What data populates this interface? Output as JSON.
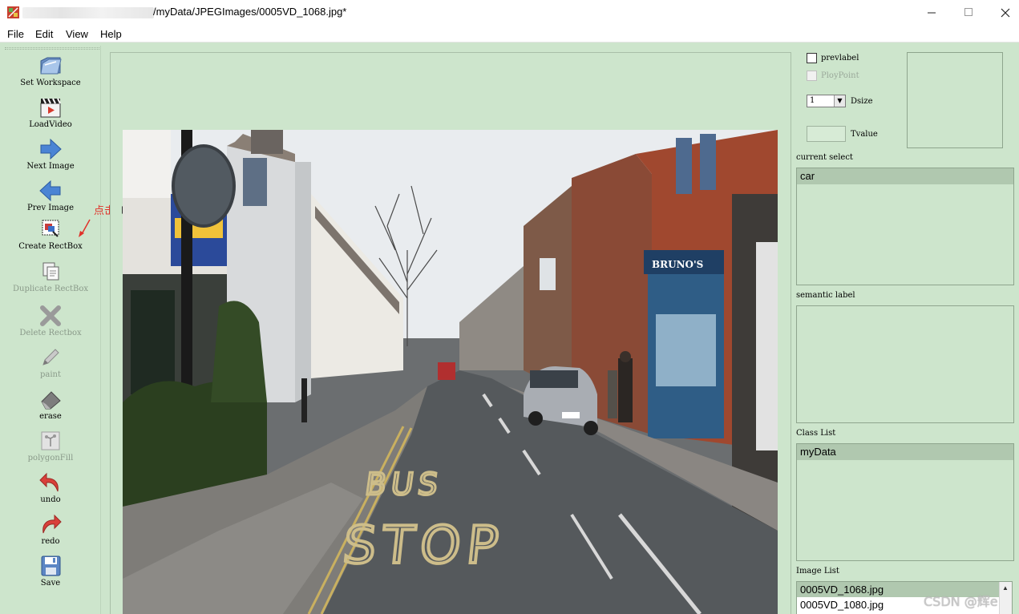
{
  "window": {
    "title": "/myData/JPEGImages/0005VD_1068.jpg*",
    "minimize": "—",
    "maximize": "☐",
    "close": "✕"
  },
  "menu": [
    "File",
    "Edit",
    "View",
    "Help"
  ],
  "toolbar": [
    {
      "label": "Set Workspace",
      "icon": "folder-icon",
      "enabled": true
    },
    {
      "label": "LoadVideo",
      "icon": "video-clapper-icon",
      "enabled": true
    },
    {
      "label": "Next Image",
      "icon": "arrow-right-icon",
      "enabled": true
    },
    {
      "label": "Prev Image",
      "icon": "arrow-left-icon",
      "enabled": true
    },
    {
      "label": "Create RectBox",
      "icon": "create-rectbox-icon",
      "enabled": true
    },
    {
      "label": "Duplicate RectBox",
      "icon": "duplicate-icon",
      "enabled": false
    },
    {
      "label": "Delete Rectbox",
      "icon": "delete-icon",
      "enabled": false
    },
    {
      "label": "paint",
      "icon": "pencil-icon",
      "enabled": false
    },
    {
      "label": "erase",
      "icon": "eraser-icon",
      "enabled": true
    },
    {
      "label": "polygonFill",
      "icon": "polygon-fill-icon",
      "enabled": false
    },
    {
      "label": "undo",
      "icon": "undo-icon",
      "enabled": true
    },
    {
      "label": "redo",
      "icon": "redo-icon",
      "enabled": true
    },
    {
      "label": "Save",
      "icon": "save-icon",
      "enabled": true
    }
  ],
  "annotation": "点击",
  "panel": {
    "prevlabel": "prevlabel",
    "ploypoint": "PloyPoint",
    "dsize_value": "1",
    "dsize_label": "Dsize",
    "tvalue_label": "Tvalue",
    "current_select_label": "current select",
    "current_select_items": [
      "car"
    ],
    "semantic_label": "semantic label",
    "class_list_label": "Class List",
    "class_list_items": [
      "myData"
    ],
    "image_list_label": "Image List",
    "image_list_items": [
      "0005VD_1068.jpg",
      "0005VD_1080.jpg"
    ]
  },
  "photo": {
    "road_marking_1": "BUS",
    "road_marking_2": "STOP",
    "shop_sign": "BRUNO'S"
  },
  "watermark": "CSDN @辉e",
  "colors": {
    "app_bg": "#cde5cc",
    "selection": "#b0c8af",
    "annotation": "#e0322a"
  }
}
